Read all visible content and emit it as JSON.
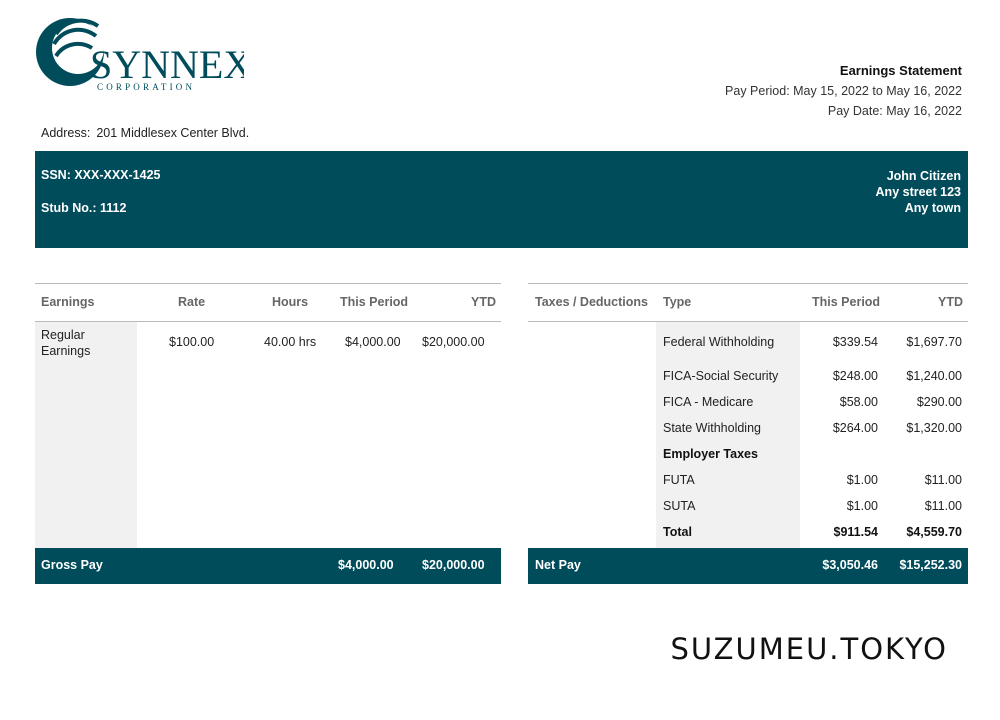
{
  "company": {
    "name": "SYNNEX",
    "sub": "CORPORATION",
    "address_label": "Address:",
    "address": "201 Middlesex Center Blvd."
  },
  "statement": {
    "title": "Earnings Statement",
    "pay_period": "Pay Period: May 15, 2022 to May 16, 2022",
    "pay_date": "Pay Date: May 16, 2022"
  },
  "banner": {
    "ssn": "SSN: XXX-XXX-1425",
    "stub": "Stub No.: 1112",
    "employee_name": "John Citizen",
    "employee_street": "Any street 123",
    "employee_town": "Any town"
  },
  "earnings": {
    "headers": {
      "earnings": "Earnings",
      "rate": "Rate",
      "hours": "Hours",
      "this_period": "This Period",
      "ytd": "YTD"
    },
    "row": {
      "label_1": "Regular",
      "label_2": "Earnings",
      "rate": "$100.00",
      "hours": "40.00 hrs",
      "this_period": "$4,000.00",
      "ytd": "$20,000.00"
    },
    "footer": {
      "label": "Gross Pay",
      "this_period": "$4,000.00",
      "ytd": "$20,000.00"
    }
  },
  "taxes": {
    "headers": {
      "taxes": "Taxes / Deductions",
      "type": "Type",
      "this_period": "This Period",
      "ytd": "YTD"
    },
    "rows": [
      {
        "type": "Federal Withholding",
        "this_period": "$339.54",
        "ytd": "$1,697.70"
      },
      {
        "type": "FICA-Social Security",
        "this_period": "$248.00",
        "ytd": "$1,240.00"
      },
      {
        "type": "FICA - Medicare",
        "this_period": "$58.00",
        "ytd": "$290.00"
      },
      {
        "type": "State Withholding",
        "this_period": "$264.00",
        "ytd": "$1,320.00"
      },
      {
        "type": "Employer Taxes",
        "this_period": "",
        "ytd": ""
      },
      {
        "type": "FUTA",
        "this_period": "$1.00",
        "ytd": "$11.00"
      },
      {
        "type": "SUTA",
        "this_period": "$1.00",
        "ytd": "$11.00"
      },
      {
        "type": "Total",
        "this_period": "$911.54",
        "ytd": "$4,559.70"
      }
    ],
    "footer": {
      "label": "Net Pay",
      "this_period": "$3,050.46",
      "ytd": "$15,252.30"
    }
  },
  "watermark": "SUZUMEU.TOKYO",
  "colors": {
    "brand": "#014c5b",
    "shade": "#f1f1f1"
  }
}
